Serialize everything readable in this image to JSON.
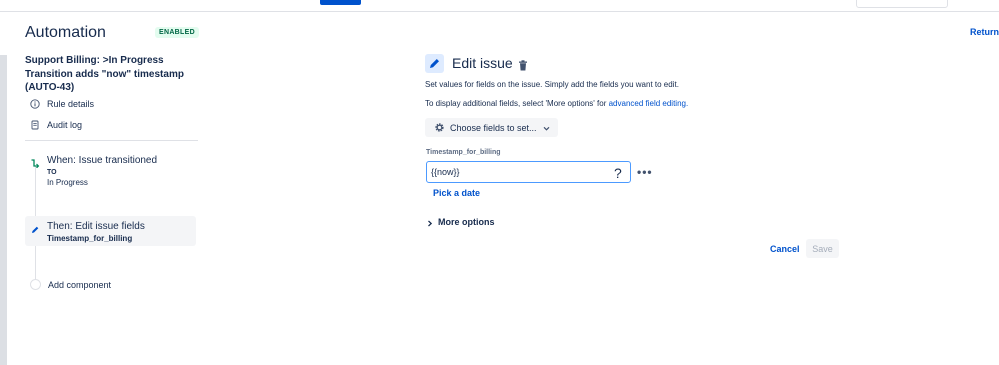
{
  "sidebar": {
    "title": "Automation",
    "status_badge": "ENABLED",
    "rule_name": "Support Billing: >In Progress Transition adds \"now\" timestamp (AUTO-43)",
    "nav": [
      {
        "label": "Rule details",
        "icon": "info-icon"
      },
      {
        "label": "Audit log",
        "icon": "document-icon"
      }
    ],
    "components": {
      "when": {
        "title": "When: Issue transitioned",
        "to_label": "TO",
        "to_value": "In Progress",
        "icon": "transition-icon"
      },
      "then": {
        "title": "Then: Edit issue fields",
        "field": "Timestamp_for_billing",
        "icon": "pencil-icon"
      },
      "add_label": "Add component"
    }
  },
  "header": {
    "return_link": "Return t"
  },
  "main": {
    "title": "Edit issue",
    "help_text_1": "Set values for fields on the issue. Simply add the fields you want to edit.",
    "help_text_2_prefix": "To display additional fields, select 'More options' for ",
    "help_text_2_link": "advanced field editing.",
    "choose_fields_label": "Choose fields to set...",
    "field": {
      "label": "Timestamp_for_billing",
      "value": "{{now}}",
      "help_glyph": "?",
      "more_glyph": "•••"
    },
    "pick_date_label": "Pick a date",
    "more_options_label": "More options",
    "cancel_label": "Cancel",
    "save_label": "Save"
  },
  "colors": {
    "accent": "#0052cc",
    "badge_text": "#006644",
    "badge_bg": "#e3fcef",
    "text": "#172b4d"
  }
}
